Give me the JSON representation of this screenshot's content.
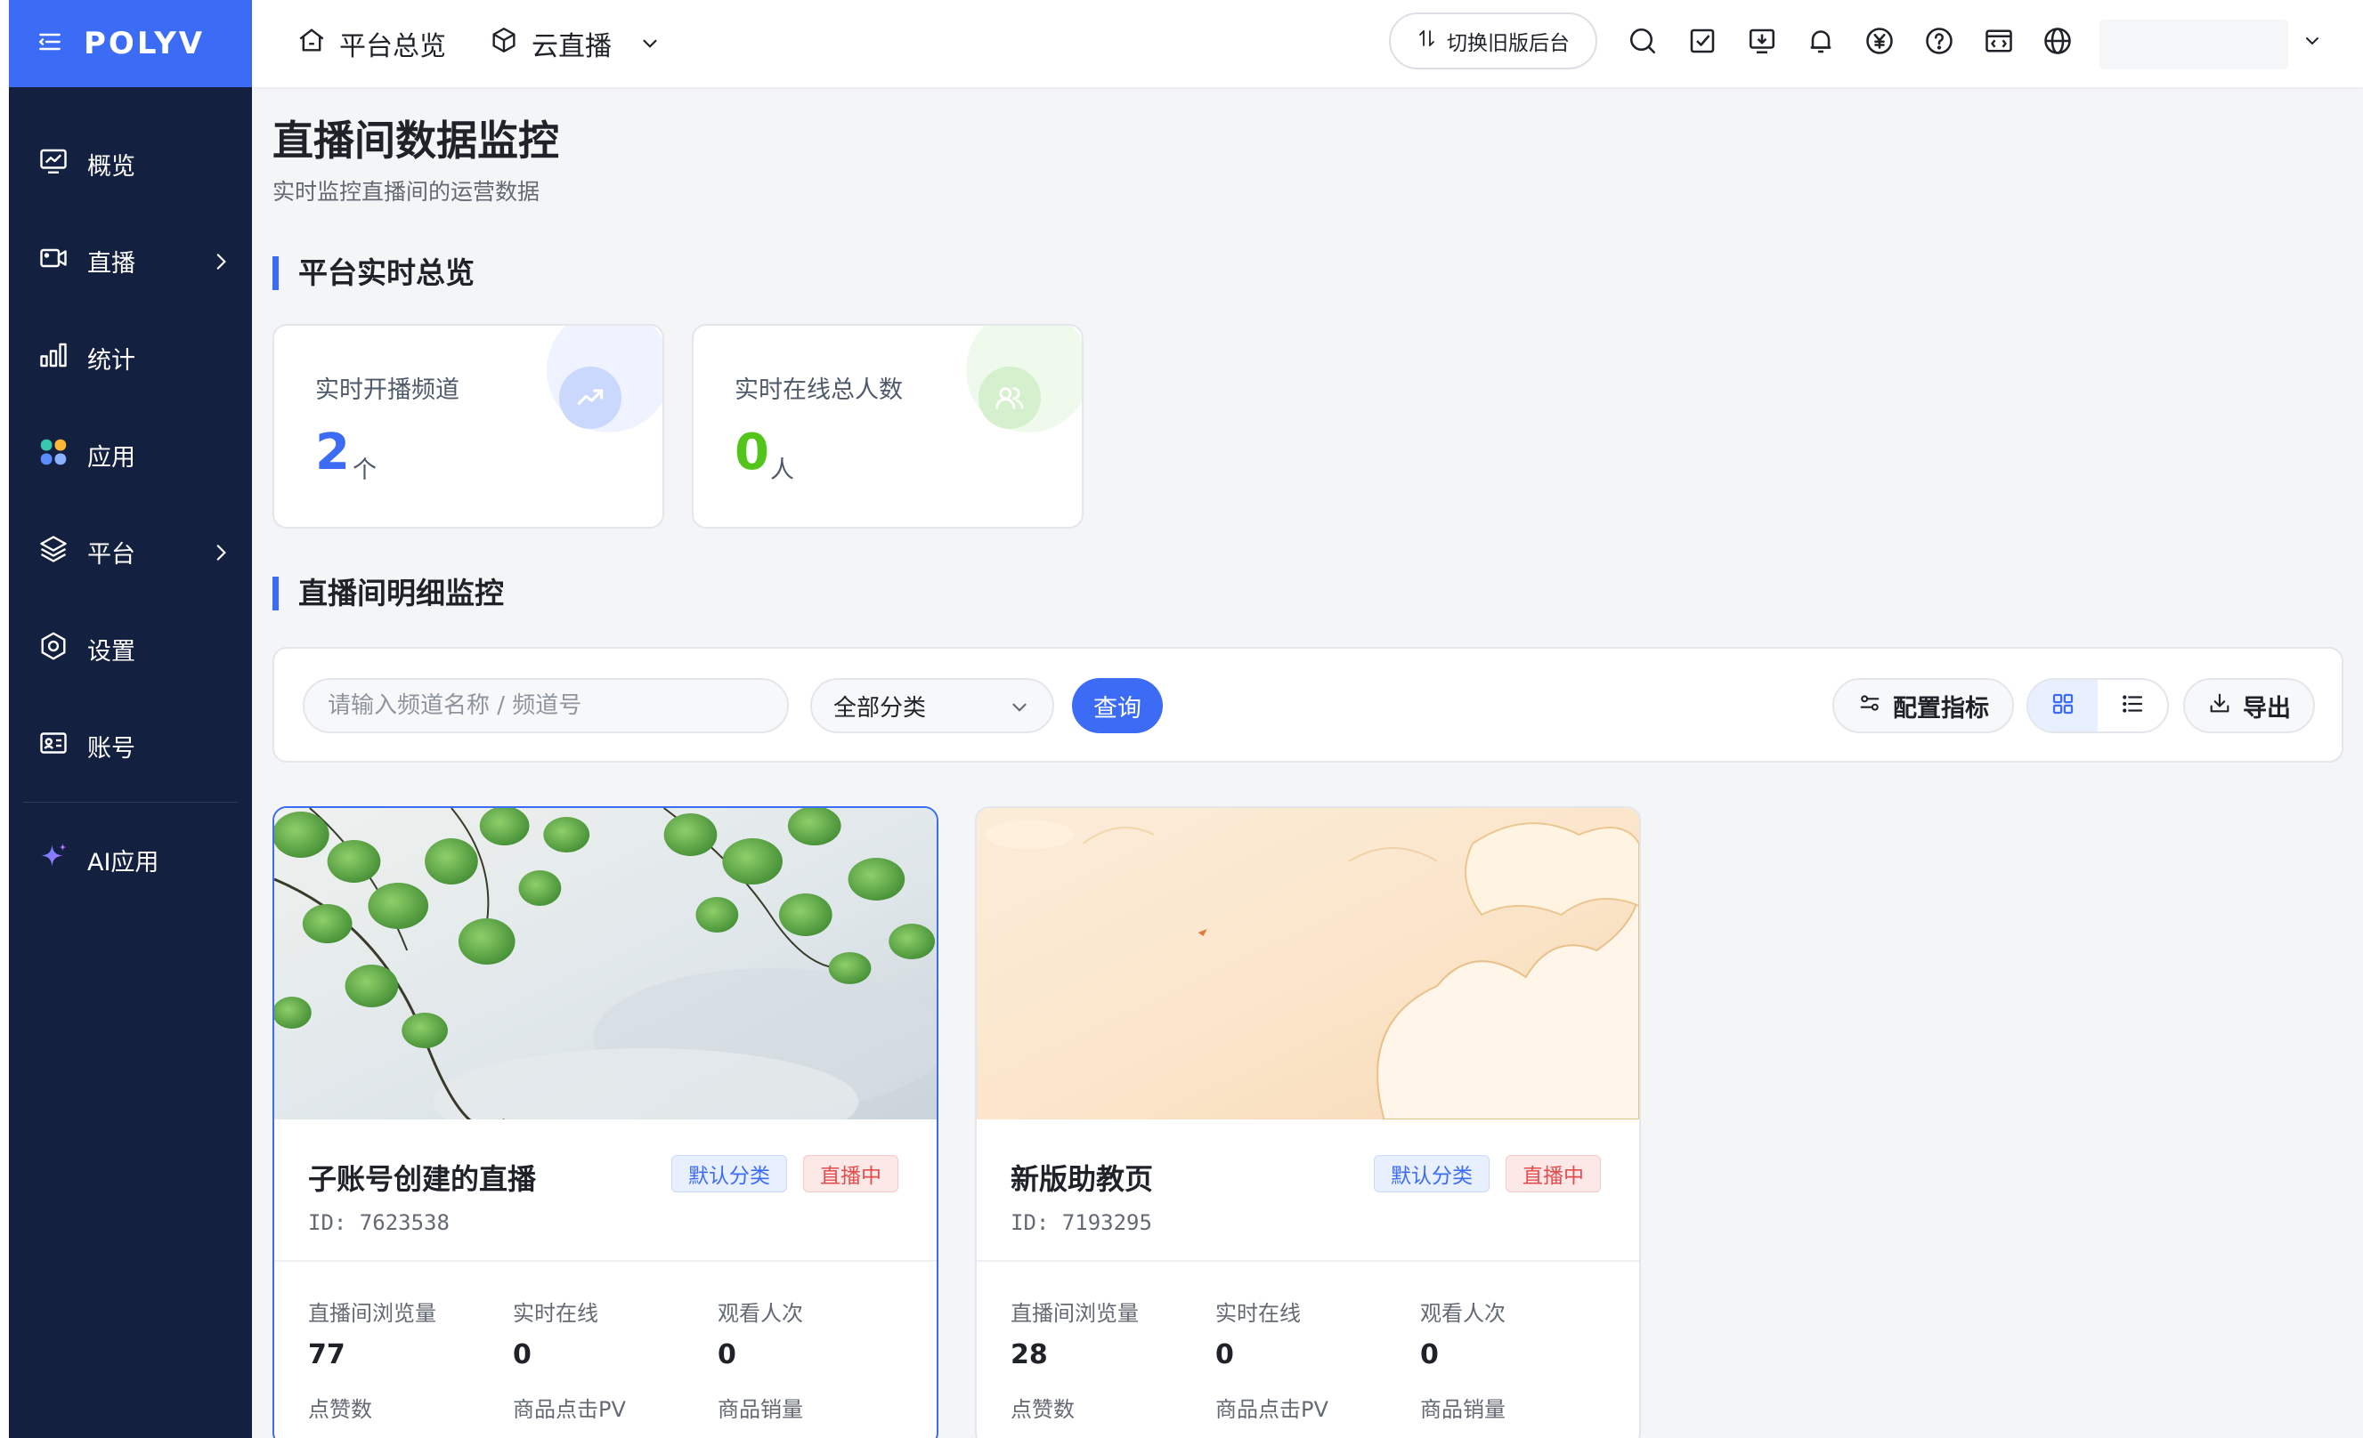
{
  "brand": {
    "name": "POLYV"
  },
  "sidebar": {
    "items": [
      {
        "label": "概览",
        "icon": "monitor-chart-icon"
      },
      {
        "label": "直播",
        "icon": "video-camera-icon",
        "has_children": true
      },
      {
        "label": "统计",
        "icon": "bar-chart-icon"
      },
      {
        "label": "应用",
        "icon": "apps-icon"
      },
      {
        "label": "平台",
        "icon": "layers-icon",
        "has_children": true
      },
      {
        "label": "设置",
        "icon": "gear-icon"
      },
      {
        "label": "账号",
        "icon": "id-card-icon"
      }
    ],
    "ai_item": {
      "label": "AI应用",
      "icon": "sparkle-icon"
    }
  },
  "topbar": {
    "home_label": "平台总览",
    "product_label": "云直播",
    "switch_label": "切换旧版后台"
  },
  "page": {
    "title": "直播间数据监控",
    "subtitle": "实时监控直播间的运营数据"
  },
  "overview": {
    "section_title": "平台实时总览",
    "cards": [
      {
        "label": "实时开播频道",
        "value": "2",
        "unit": "个",
        "color": "#3c6cf5",
        "icon": "trend-up-icon"
      },
      {
        "label": "实时在线总人数",
        "value": "0",
        "unit": "人",
        "color": "#52c41a",
        "icon": "users-icon"
      }
    ]
  },
  "detail": {
    "section_title": "直播间明细监控",
    "search_placeholder": "请输入频道名称 / 频道号",
    "category_select": "全部分类",
    "query_label": "查询",
    "config_label": "配置指标",
    "export_label": "导出",
    "view_mode": "grid"
  },
  "rooms": [
    {
      "name": "子账号创建的直播",
      "id_text": "ID: 7623538",
      "category": "默认分类",
      "status": "直播中",
      "metrics": [
        {
          "label": "直播间浏览量",
          "value": "77"
        },
        {
          "label": "实时在线",
          "value": "0"
        },
        {
          "label": "观看人次",
          "value": "0"
        },
        {
          "label": "点赞数",
          "value": ""
        },
        {
          "label": "商品点击PV",
          "value": ""
        },
        {
          "label": "商品销量",
          "value": ""
        }
      ]
    },
    {
      "name": "新版助教页",
      "id_text": "ID: 7193295",
      "category": "默认分类",
      "status": "直播中",
      "metrics": [
        {
          "label": "直播间浏览量",
          "value": "28"
        },
        {
          "label": "实时在线",
          "value": "0"
        },
        {
          "label": "观看人次",
          "value": "0"
        },
        {
          "label": "点赞数",
          "value": ""
        },
        {
          "label": "商品点击PV",
          "value": ""
        },
        {
          "label": "商品销量",
          "value": ""
        }
      ]
    }
  ],
  "colors": {
    "accent": "#3c6cf5",
    "sidebar_bg": "#14203f",
    "live_tag": "#e34d4d",
    "online_green": "#52c41a"
  }
}
